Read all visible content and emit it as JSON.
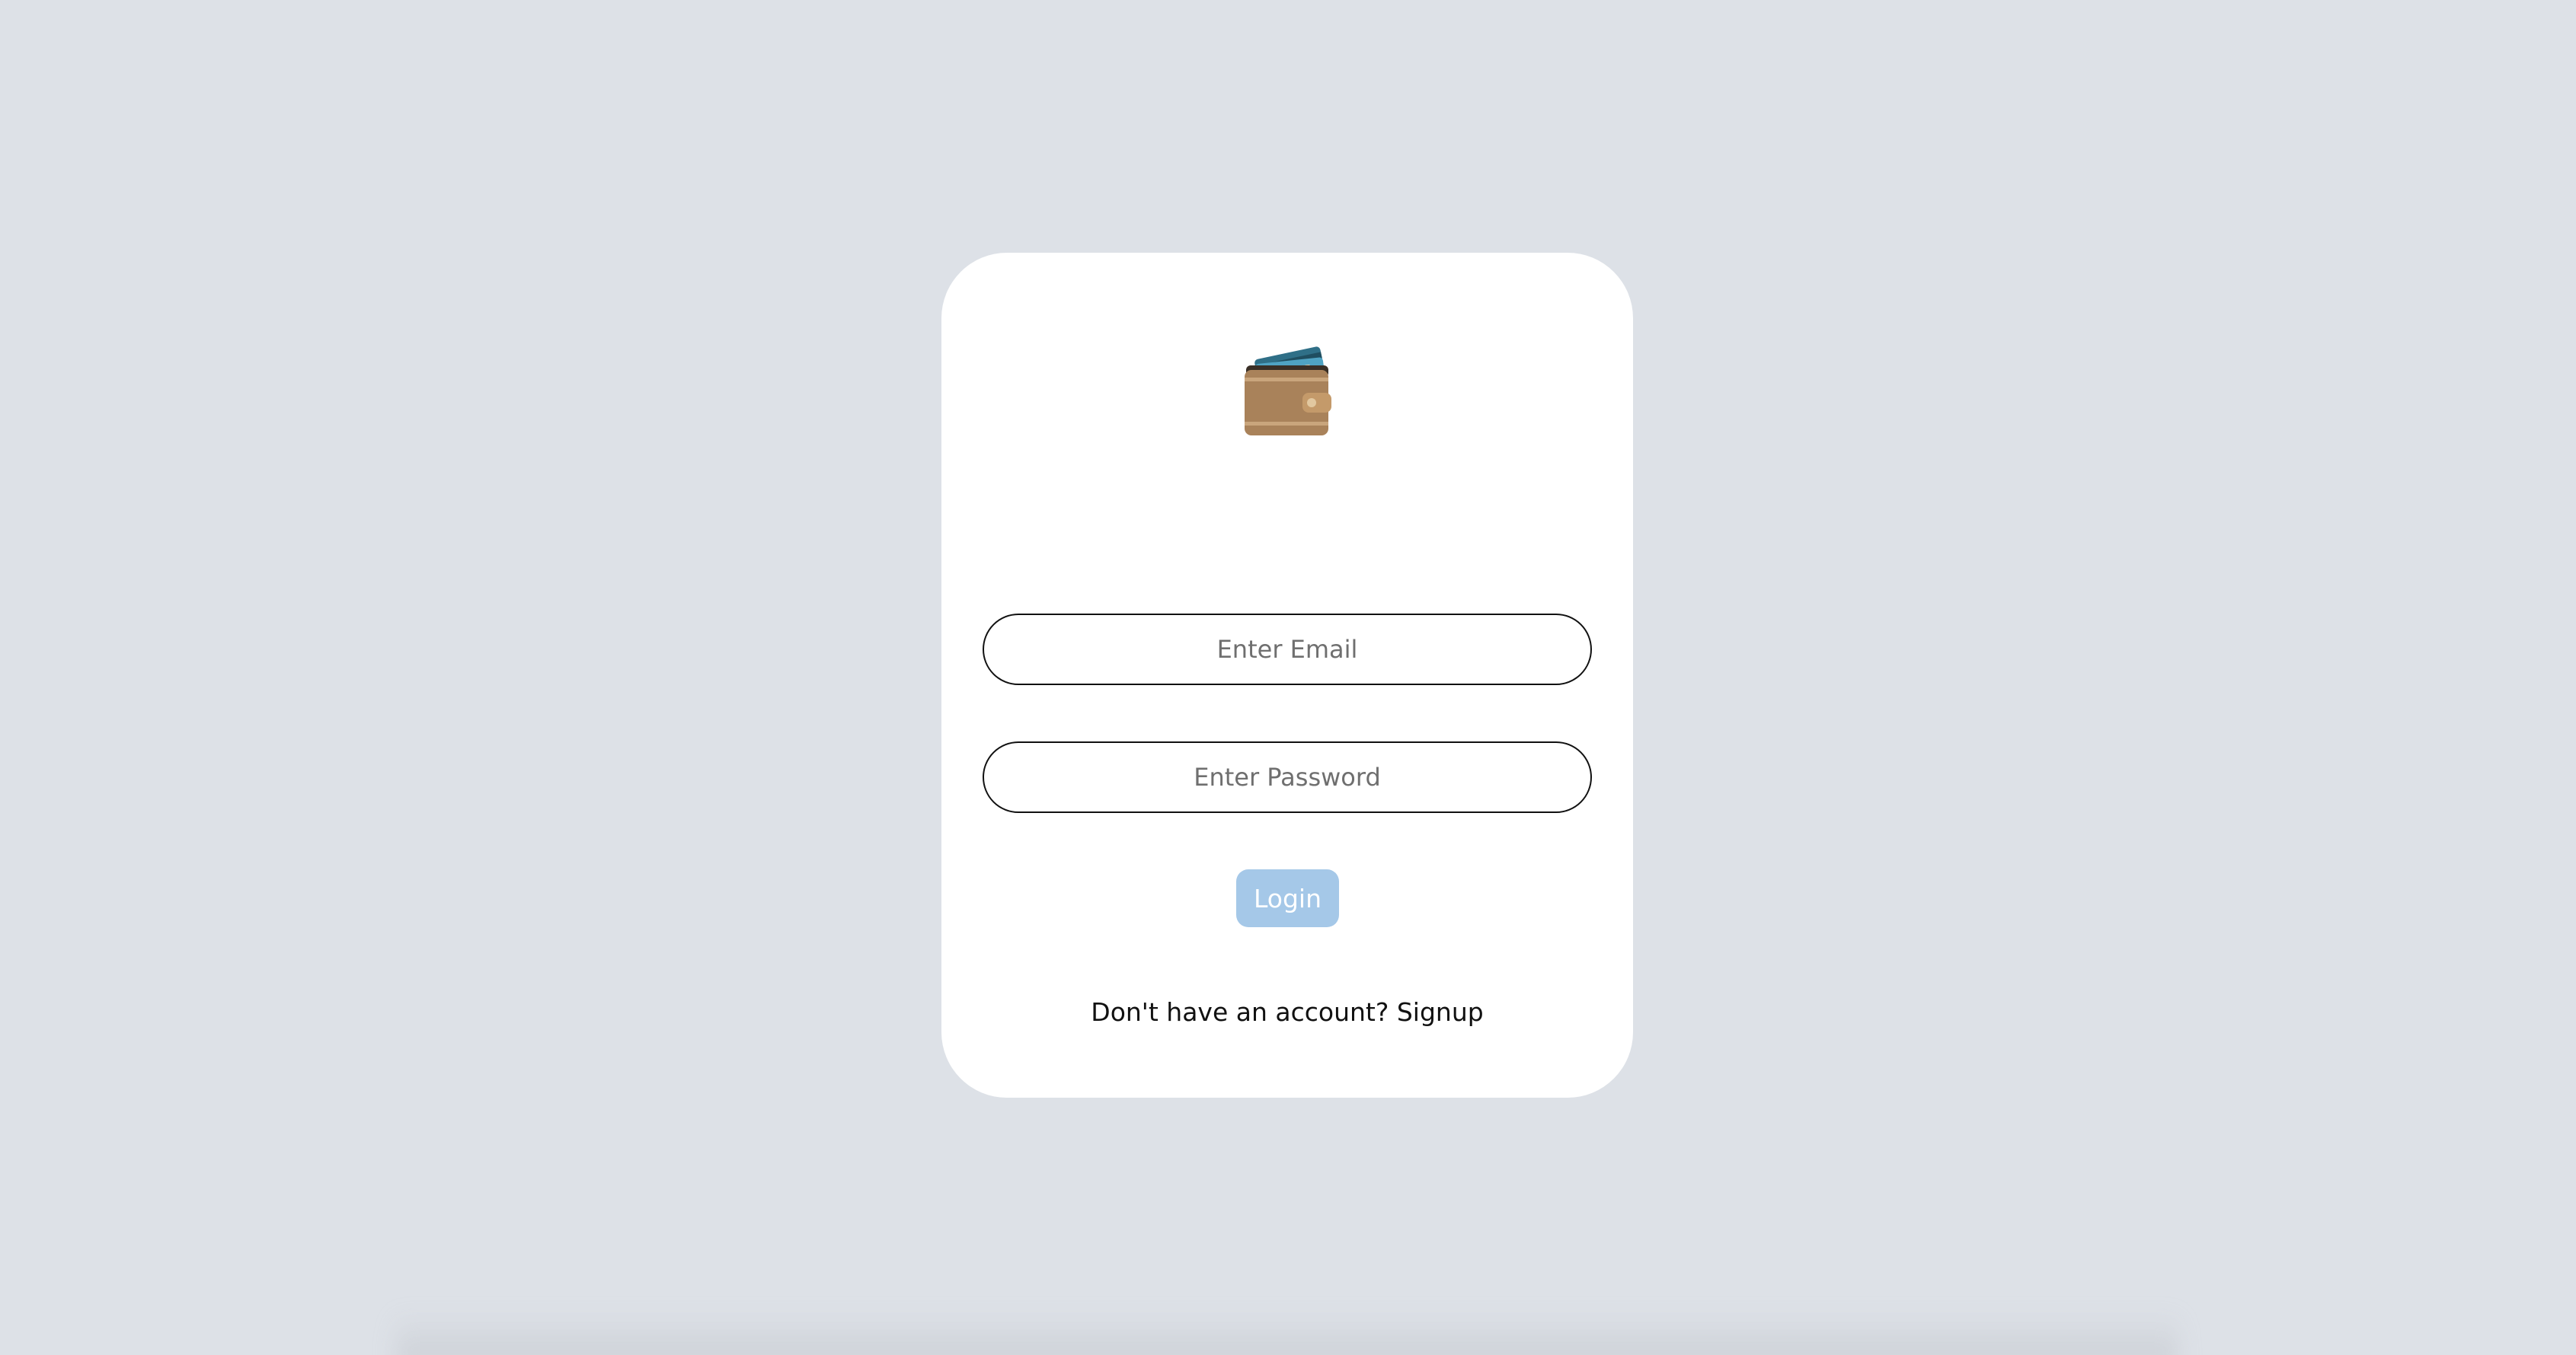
{
  "logo": {
    "icon": "wallet-icon"
  },
  "form": {
    "email_placeholder": "Enter Email",
    "password_placeholder": "Enter Password",
    "login_label": "Login",
    "signup_prompt": "Don't have an account? ",
    "signup_link": "Signup"
  },
  "colors": {
    "background": "#dde1e7",
    "card": "#ffffff",
    "login_button": "#a5c8e8"
  }
}
